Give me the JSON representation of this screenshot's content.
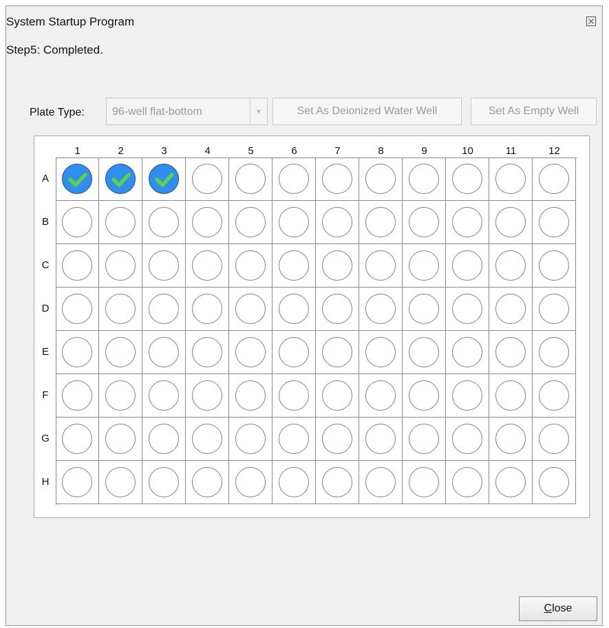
{
  "window": {
    "title": "System Startup Program",
    "close_glyph": "☒"
  },
  "status": {
    "step_text": "Step5:  Completed."
  },
  "plate": {
    "label": "Plate Type:",
    "selected": "96-well flat-bottom",
    "dropdown_arrow": "▼"
  },
  "buttons": {
    "set_water": "Set As Deionized Water Well",
    "set_empty": "Set As Empty Well",
    "close_mnemonic": "C",
    "close_rest": "lose"
  },
  "grid": {
    "columns": [
      "1",
      "2",
      "3",
      "4",
      "5",
      "6",
      "7",
      "8",
      "9",
      "10",
      "11",
      "12"
    ],
    "rows": [
      "A",
      "B",
      "C",
      "D",
      "E",
      "F",
      "G",
      "H"
    ],
    "completed_wells": [
      "A1",
      "A2",
      "A3"
    ]
  },
  "colors": {
    "completed_fill": "#2f8ef0",
    "check": "#5cd24a"
  }
}
